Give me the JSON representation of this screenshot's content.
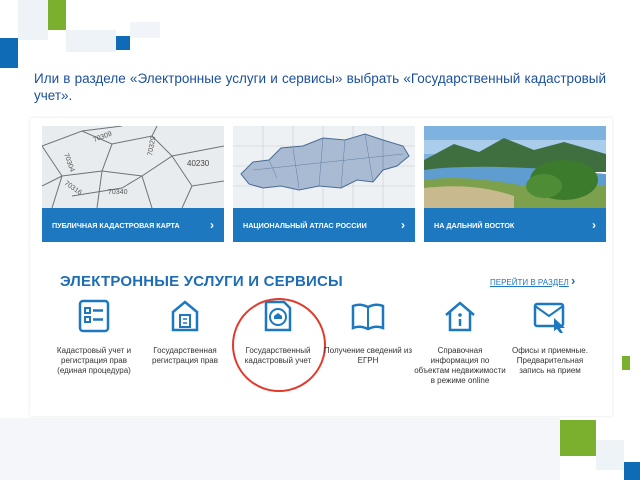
{
  "instruction": "Или в разделе «Электронные услуги и сервисы» выбрать «Государственный кадастровый учет».",
  "cards": [
    {
      "label": "ПУБЛИЧНАЯ КАДАСТРОВАЯ КАРТА",
      "icon": "chevron-right-icon"
    },
    {
      "label": "НАЦИОНАЛЬНЫЙ АТЛАС РОССИИ",
      "icon": "chevron-right-icon"
    },
    {
      "label": "НА ДАЛЬНИЙ ВОСТОК",
      "icon": "chevron-right-icon"
    }
  ],
  "map_parcel_numbers": [
    "70309",
    "70304",
    "40230",
    "70329",
    "70316",
    "70340"
  ],
  "section": {
    "title": "ЭЛЕКТРОННЫЕ УСЛУГИ И СЕРВИСЫ",
    "link": "ПЕРЕЙТИ В РАЗДЕЛ"
  },
  "services": [
    {
      "label": "Кадастровый учет и регистрация прав (единая процедура)",
      "icon": "checklist-document-icon"
    },
    {
      "label": "Государственная регистрация прав",
      "icon": "house-document-icon"
    },
    {
      "label": "Государственный кадастровый учет",
      "icon": "house-stamp-icon"
    },
    {
      "label": "Получение сведений из ЕГРН",
      "icon": "open-book-icon"
    },
    {
      "label": "Справочная информация по объектам недвижимости в режиме online",
      "icon": "house-info-icon"
    },
    {
      "label": "Офисы и приемные. Предварительная запись на прием",
      "icon": "envelope-cursor-icon"
    }
  ],
  "colors": {
    "accent_blue": "#1d78bf",
    "text_blue": "#1b4f9c",
    "highlight_red": "#e2392b",
    "deco_blue": "#0f6bb5",
    "deco_green": "#7bb02f"
  }
}
